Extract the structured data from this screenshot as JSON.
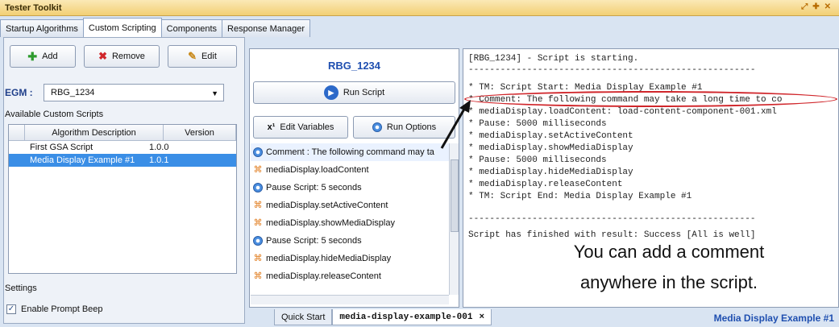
{
  "window": {
    "title": "Tester Toolkit"
  },
  "tabs": [
    "Startup Algorithms",
    "Custom Scripting",
    "Components",
    "Response Manager"
  ],
  "toolbar": {
    "add_label": "Add",
    "remove_label": "Remove",
    "edit_label": "Edit"
  },
  "egm": {
    "label": "EGM :",
    "selected": "RBG_1234"
  },
  "scripts": {
    "title": "Available Custom Scripts",
    "columns": [
      "Algorithm Description",
      "Version"
    ],
    "rows": [
      {
        "description": "First GSA Script",
        "version": "1.0.0"
      },
      {
        "description": "Media Display Example #1",
        "version": "1.0.1"
      }
    ]
  },
  "settings": {
    "title": "Settings",
    "prompt_beep_label": "Enable Prompt Beep"
  },
  "script_panel": {
    "egm_name": "RBG_1234",
    "run_script_label": "Run Script",
    "edit_variables_label": "Edit Variables",
    "run_options_label": "Run Options",
    "steps": [
      "Comment : The following command may ta",
      "mediaDisplay.loadContent",
      "Pause Script: 5 seconds",
      "mediaDisplay.setActiveContent",
      "mediaDisplay.showMediaDisplay",
      "Pause Script: 5 seconds",
      "mediaDisplay.hideMediaDisplay",
      "mediaDisplay.releaseContent"
    ]
  },
  "console": {
    "lines": [
      "[RBG_1234] - Script is starting.",
      "------------------------------------------------------",
      "* TM: Script Start: Media Display Example #1",
      "* Comment: The following command may take a long time to co",
      "* mediaDisplay.loadContent: load-content-component-001.xml",
      "* Pause: 5000 milliseconds",
      "* mediaDisplay.setActiveContent",
      "* mediaDisplay.showMediaDisplay",
      "* Pause: 5000 milliseconds",
      "* mediaDisplay.hideMediaDisplay",
      "* mediaDisplay.releaseContent",
      "* TM: Script End: Media Display Example #1",
      "------------------------------------------------------",
      "Script has finished with result: Success [All is well]"
    ],
    "annotation_line1": "You can add a comment",
    "annotation_line2": "anywhere in the script."
  },
  "bottom_tabs": {
    "quick_start": "Quick Start",
    "active": "media-display-example-001",
    "close": "×"
  },
  "status_right": "Media Display Example #1",
  "colors": {
    "accent": "#1f4fb0",
    "highlight": "#d0262b",
    "selection": "#3a8ee6"
  }
}
